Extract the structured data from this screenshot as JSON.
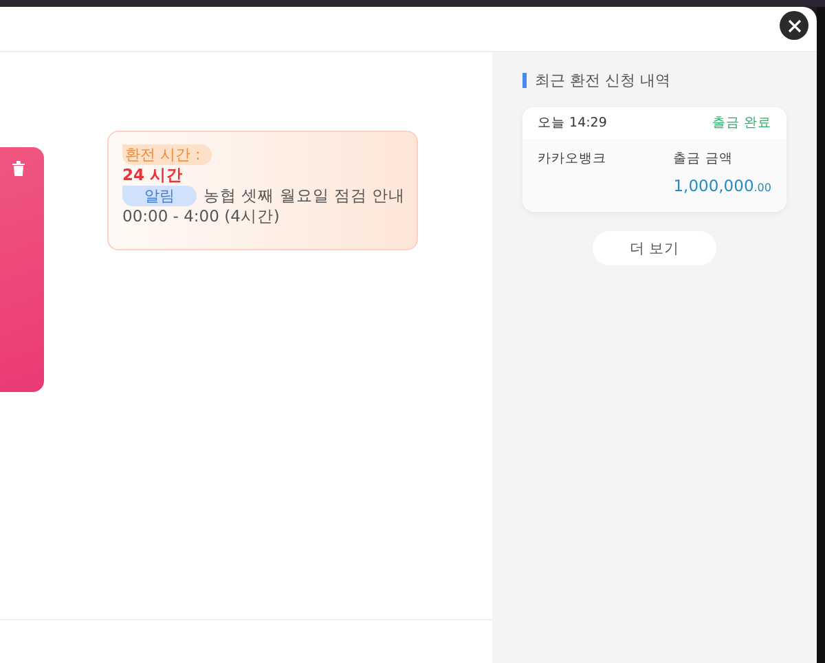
{
  "notice": {
    "label": "환전 시간 :",
    "hours": "24 시간",
    "tag": "알림",
    "title": "농협 셋째 월요일 점검 안내",
    "time": "00:00 - 4:00 (4시간)"
  },
  "history": {
    "title": "최근 환전 신청 내역",
    "items": [
      {
        "time": "오늘 14:29",
        "status": "출금 완료",
        "bank": "카카오뱅크",
        "amount_label": "출금 금액",
        "amount": "1,000,000",
        "decimals": ".00"
      }
    ],
    "more": "더 보기"
  }
}
